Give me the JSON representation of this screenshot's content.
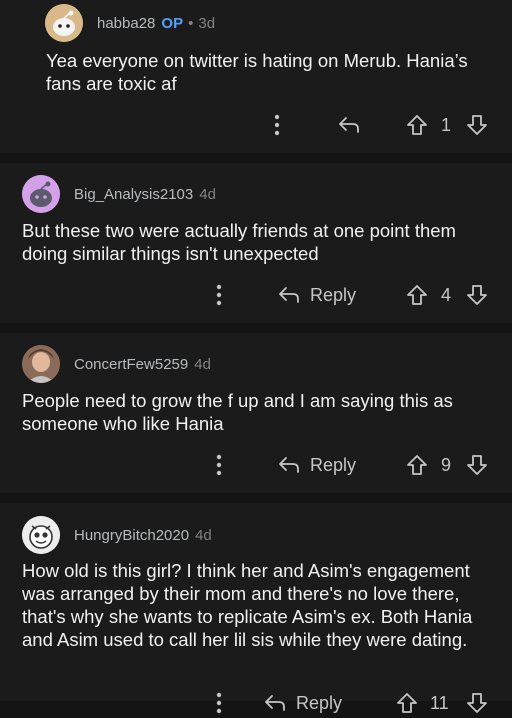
{
  "comments": [
    {
      "username": "habba28",
      "op_badge": "OP",
      "separator": "•",
      "age": "3d",
      "text": "Yea everyone on twitter is hating on Merub. Hania’s fans are toxic af",
      "reply_label": "",
      "vote_count": "1"
    },
    {
      "username": "Big_Analysis2103",
      "age": "4d",
      "text": "But these two were actually friends at one point them doing similar things isn't unexpected",
      "reply_label": "Reply",
      "vote_count": "4"
    },
    {
      "username": "ConcertFew5259",
      "age": "4d",
      "text": "People need to grow the f up and I am saying this as someone who like Hania",
      "reply_label": "Reply",
      "vote_count": "9"
    },
    {
      "username": "HungryBitch2020",
      "age": "4d",
      "text": "How old is this girl? I think her and Asim's engagement was arranged by their mom and there's no love there, that's why she wants to replicate Asim's ex. Both Hania and Asim used to call her lil sis while they were dating.",
      "reply_label": "Reply",
      "vote_count": "11"
    }
  ],
  "icons": {
    "more": "kebab-menu-icon",
    "reply": "reply-arrow-icon",
    "upvote": "upvote-arrow-icon",
    "downvote": "downvote-arrow-icon"
  },
  "colors": {
    "background": "#141414",
    "card": "#1b1b1b",
    "op_badge": "#4fa3ff",
    "username": "#b8bbbe",
    "text": "#f1f1f1"
  }
}
